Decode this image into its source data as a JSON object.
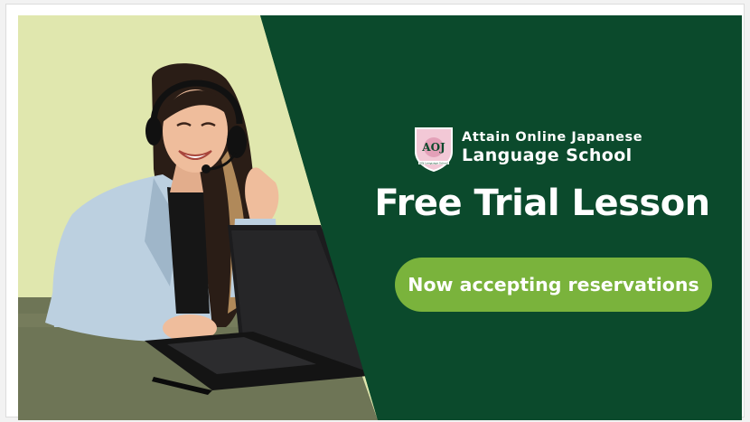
{
  "banner": {
    "school_name_line1": "Attain Online Japanese",
    "school_name_line2": "Language School",
    "logo": {
      "monogram": "AOJ",
      "tagline": "AOJ Language School",
      "icon": "shield-crest-icon"
    },
    "headline": "Free Trial Lesson",
    "cta_label": "Now accepting reservations",
    "photo": "smiling-teacher-with-headset-at-laptop"
  },
  "colors": {
    "panel_green": "#0b4a2c",
    "cta_green": "#7ab33c",
    "pale_background": "#e0e7ae",
    "desk_olive": "#6e7556",
    "text_white": "#ffffff"
  }
}
